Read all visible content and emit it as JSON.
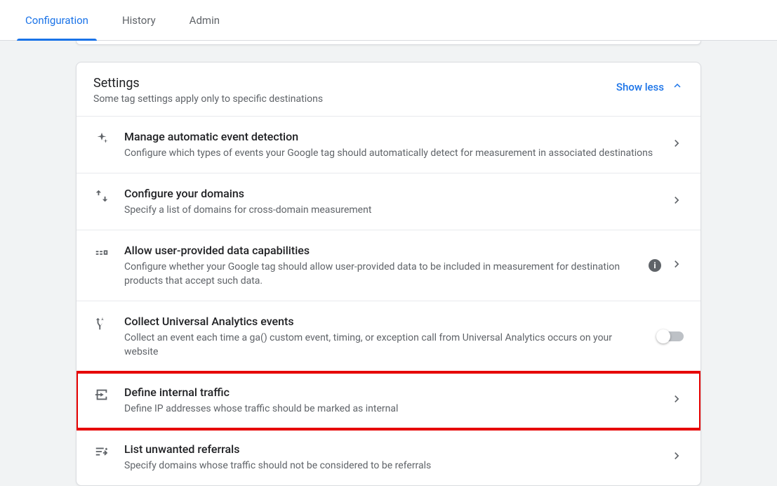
{
  "tabs": {
    "configuration": "Configuration",
    "history": "History",
    "admin": "Admin"
  },
  "section": {
    "title": "Settings",
    "subtitle": "Some tag settings apply only to specific destinations",
    "toggle_label": "Show less"
  },
  "rows": {
    "auto_event": {
      "title": "Manage automatic event detection",
      "desc": "Configure which types of events your Google tag should automatically detect for measurement in associated destinations"
    },
    "domains": {
      "title": "Configure your domains",
      "desc": "Specify a list of domains for cross-domain measurement"
    },
    "user_data": {
      "title": "Allow user-provided data capabilities",
      "desc": "Configure whether your Google tag should allow user-provided data to be included in measurement for destination products that accept such data."
    },
    "ua_events": {
      "title": "Collect Universal Analytics events",
      "desc": "Collect an event each time a ga() custom event, timing, or exception call from Universal Analytics occurs on your website"
    },
    "internal_traffic": {
      "title": "Define internal traffic",
      "desc": "Define IP addresses whose traffic should be marked as internal"
    },
    "unwanted_referrals": {
      "title": "List unwanted referrals",
      "desc": "Specify domains whose traffic should not be considered to be referrals"
    }
  }
}
